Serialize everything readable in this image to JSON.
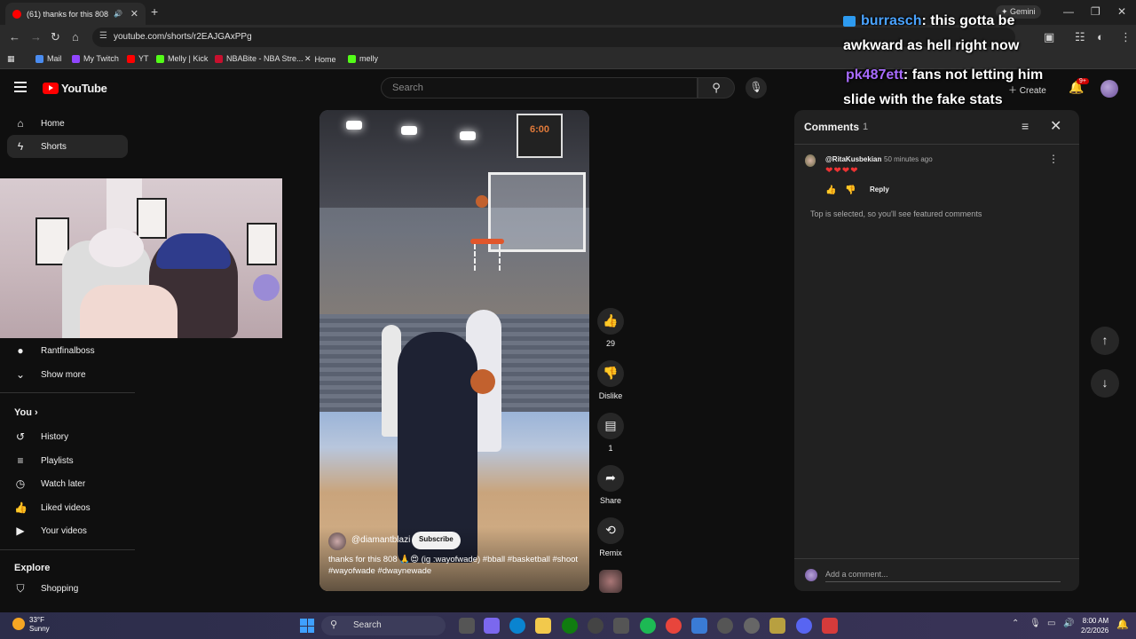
{
  "browser": {
    "tab_title": "(61) thanks for this 808",
    "url": "youtube.com/shorts/r2EAJGAxPPg",
    "gemini_label": "Gemini",
    "bookmarks": [
      "Mail",
      "My Twitch",
      "YT",
      "Melly | Kick",
      "NBABite - NBA Stre...",
      "Home",
      "melly"
    ]
  },
  "header": {
    "logo_text": "YouTube",
    "search_placeholder": "Search",
    "create_label": "Create",
    "notifications_badge": "9+"
  },
  "sidebar": {
    "home": "Home",
    "shorts": "Shorts",
    "subscription_channel": "Rantfinalboss",
    "show_more": "Show more",
    "you_heading": "You",
    "you_items": [
      "History",
      "Playlists",
      "Watch later",
      "Liked videos",
      "Your videos"
    ],
    "explore_heading": "Explore",
    "explore_items": [
      "Shopping"
    ]
  },
  "video": {
    "shot_clock": "6:00",
    "channel_handle": "@diamantblazi",
    "subscribe_label": "Subscribe",
    "caption": "thanks for this 808 🙏😍 (ig :wayofwade) #bball #basketball #shoot #wayofwade #dwaynewade"
  },
  "actions": {
    "likes": "29",
    "dislike_label": "Dislike",
    "comment_count": "1",
    "share_label": "Share",
    "remix_label": "Remix"
  },
  "comments": {
    "title": "Comments",
    "count": "1",
    "items": [
      {
        "user": "@RitaKusbekian",
        "time": "50 minutes ago",
        "text": "❤❤❤❤",
        "reply_label": "Reply"
      }
    ],
    "note": "Top is selected, so you'll see featured comments",
    "add_placeholder": "Add a comment..."
  },
  "stream_chat": [
    {
      "user": "burrasch",
      "message": ": this gotta be",
      "continuation": "awkward as hell right now"
    },
    {
      "user": "pk487ett",
      "message": ": fans not letting him",
      "continuation": "slide with the fake stats"
    }
  ],
  "taskbar": {
    "temperature": "33°F",
    "condition": "Sunny",
    "search_label": "Search",
    "time": "8:00 AM",
    "date": "2/2/2026"
  }
}
